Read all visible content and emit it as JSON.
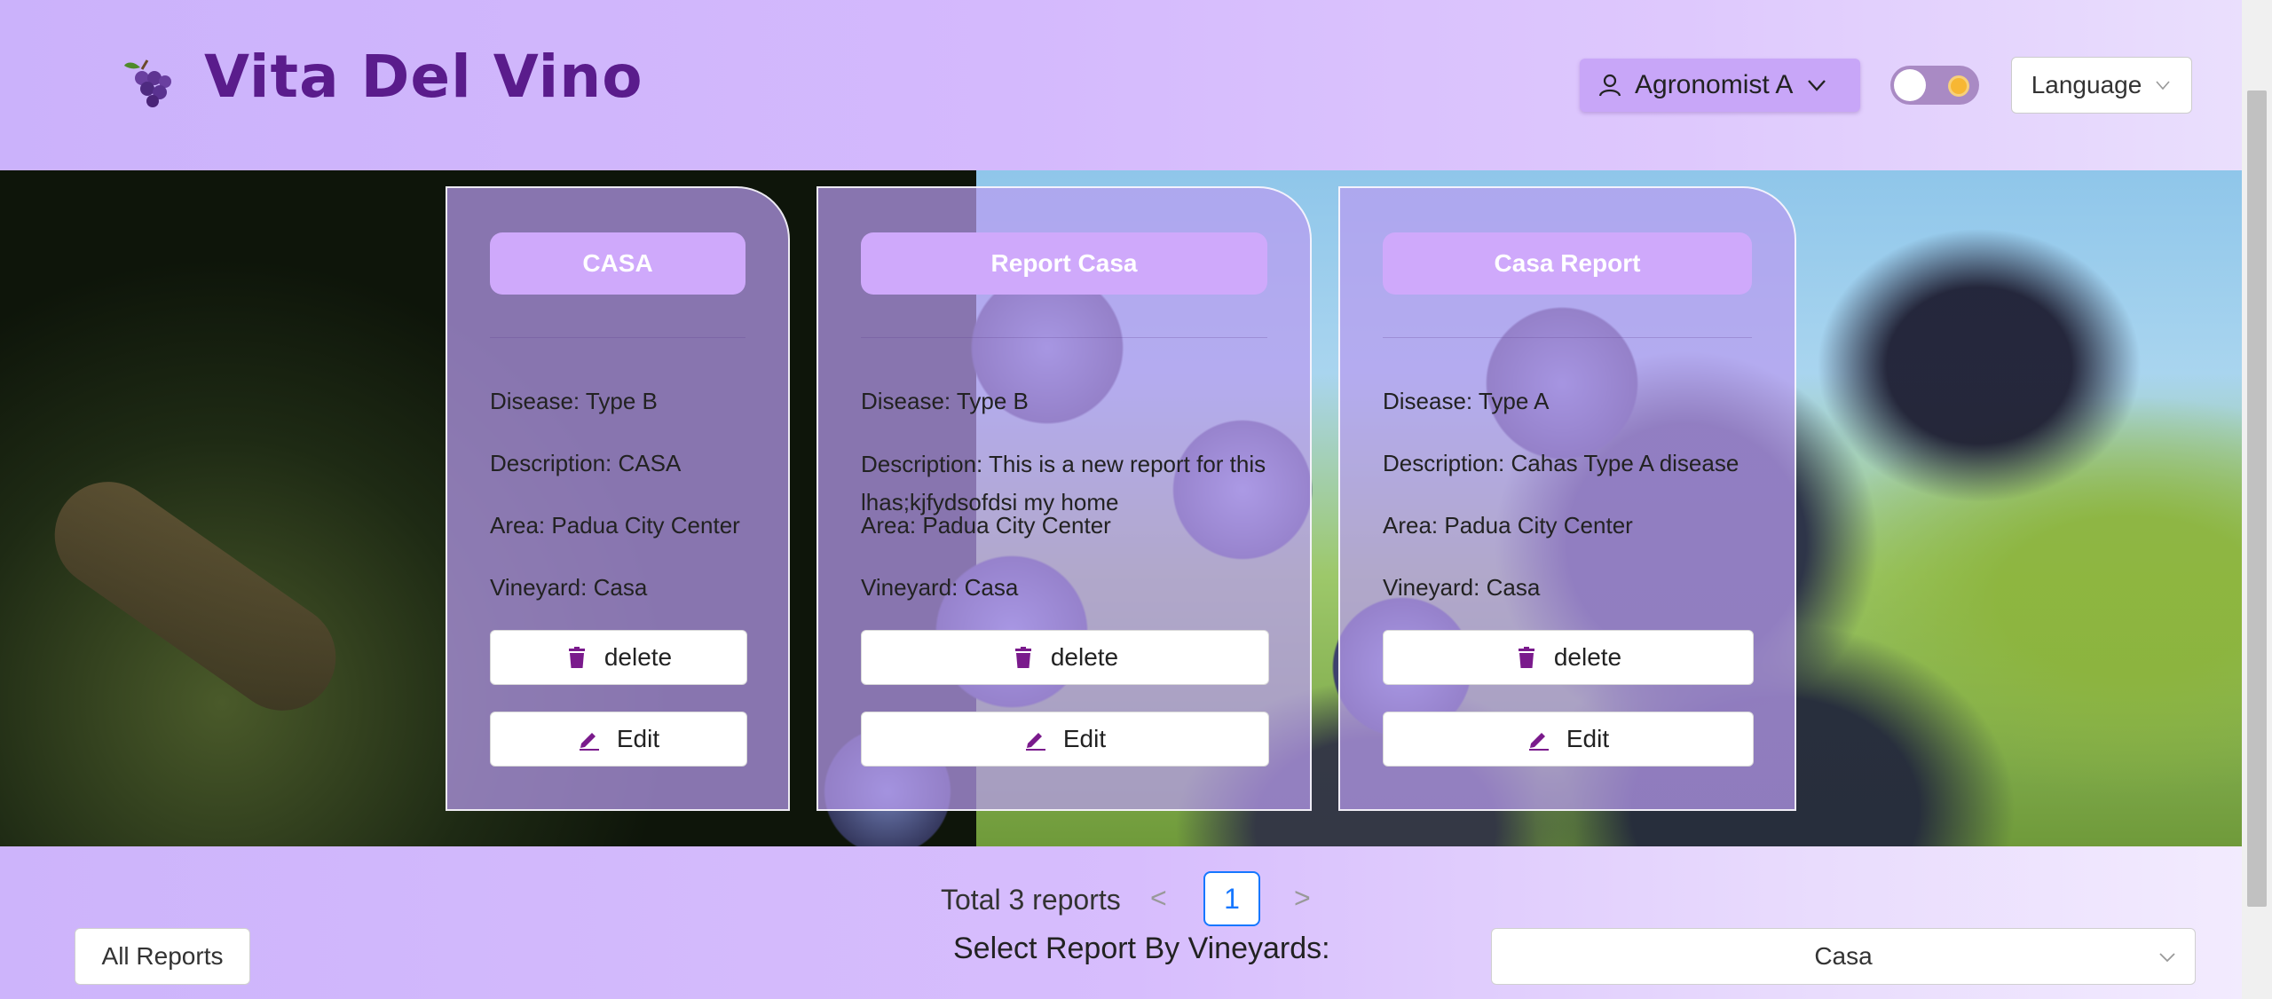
{
  "header": {
    "brand": "Vita Del Vino",
    "logo_icon": "grapes-icon",
    "user_label": "Agronomist A",
    "language_label": "Language",
    "accent_color": "#5a1c8c"
  },
  "reports": [
    {
      "title": "CASA",
      "disease": "Disease: Type B",
      "description": "Description: CASA",
      "area": "Area: Padua City Center",
      "vineyard": "Vineyard: Casa",
      "delete_label": "delete",
      "edit_label": "Edit"
    },
    {
      "title": "Report Casa",
      "disease": "Disease: Type B",
      "description": "Description: This is a new report for this lhas;kjfydsofdsi my home",
      "area": "Area: Padua City Center",
      "vineyard": "Vineyard: Casa",
      "delete_label": "delete",
      "edit_label": "Edit"
    },
    {
      "title": "Casa Report",
      "disease": "Disease: Type A",
      "description": "Description: Cahas Type A disease",
      "area": "Area: Padua City Center",
      "vineyard": "Vineyard: Casa",
      "delete_label": "delete",
      "edit_label": "Edit"
    }
  ],
  "pagination": {
    "total_text": "Total 3 reports",
    "current_page": "1",
    "prev_symbol": "<",
    "next_symbol": ">"
  },
  "filters": {
    "all_reports_label": "All Reports",
    "select_label": "Select Report By Vineyards:",
    "selected_vineyard": "Casa"
  }
}
